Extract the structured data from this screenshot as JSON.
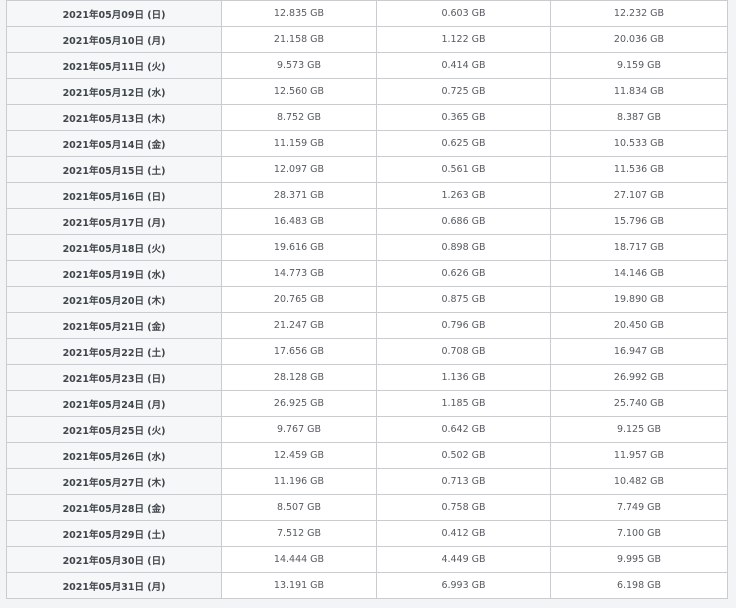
{
  "table": {
    "rows": [
      {
        "date": "2021年05月09日 (日)",
        "total": "12.835 GB",
        "upload": "0.603 GB",
        "download": "12.232 GB"
      },
      {
        "date": "2021年05月10日 (月)",
        "total": "21.158 GB",
        "upload": "1.122 GB",
        "download": "20.036 GB"
      },
      {
        "date": "2021年05月11日 (火)",
        "total": "9.573 GB",
        "upload": "0.414 GB",
        "download": "9.159 GB"
      },
      {
        "date": "2021年05月12日 (水)",
        "total": "12.560 GB",
        "upload": "0.725 GB",
        "download": "11.834 GB"
      },
      {
        "date": "2021年05月13日 (木)",
        "total": "8.752 GB",
        "upload": "0.365 GB",
        "download": "8.387 GB"
      },
      {
        "date": "2021年05月14日 (金)",
        "total": "11.159 GB",
        "upload": "0.625 GB",
        "download": "10.533 GB"
      },
      {
        "date": "2021年05月15日 (土)",
        "total": "12.097 GB",
        "upload": "0.561 GB",
        "download": "11.536 GB"
      },
      {
        "date": "2021年05月16日 (日)",
        "total": "28.371 GB",
        "upload": "1.263 GB",
        "download": "27.107 GB"
      },
      {
        "date": "2021年05月17日 (月)",
        "total": "16.483 GB",
        "upload": "0.686 GB",
        "download": "15.796 GB"
      },
      {
        "date": "2021年05月18日 (火)",
        "total": "19.616 GB",
        "upload": "0.898 GB",
        "download": "18.717 GB"
      },
      {
        "date": "2021年05月19日 (水)",
        "total": "14.773 GB",
        "upload": "0.626 GB",
        "download": "14.146 GB"
      },
      {
        "date": "2021年05月20日 (木)",
        "total": "20.765 GB",
        "upload": "0.875 GB",
        "download": "19.890 GB"
      },
      {
        "date": "2021年05月21日 (金)",
        "total": "21.247 GB",
        "upload": "0.796 GB",
        "download": "20.450 GB"
      },
      {
        "date": "2021年05月22日 (土)",
        "total": "17.656 GB",
        "upload": "0.708 GB",
        "download": "16.947 GB"
      },
      {
        "date": "2021年05月23日 (日)",
        "total": "28.128 GB",
        "upload": "1.136 GB",
        "download": "26.992 GB"
      },
      {
        "date": "2021年05月24日 (月)",
        "total": "26.925 GB",
        "upload": "1.185 GB",
        "download": "25.740 GB"
      },
      {
        "date": "2021年05月25日 (火)",
        "total": "9.767 GB",
        "upload": "0.642 GB",
        "download": "9.125 GB"
      },
      {
        "date": "2021年05月26日 (水)",
        "total": "12.459 GB",
        "upload": "0.502 GB",
        "download": "11.957 GB"
      },
      {
        "date": "2021年05月27日 (木)",
        "total": "11.196 GB",
        "upload": "0.713 GB",
        "download": "10.482 GB"
      },
      {
        "date": "2021年05月28日 (金)",
        "total": "8.507 GB",
        "upload": "0.758 GB",
        "download": "7.749 GB"
      },
      {
        "date": "2021年05月29日 (土)",
        "total": "7.512 GB",
        "upload": "0.412 GB",
        "download": "7.100 GB"
      },
      {
        "date": "2021年05月30日 (日)",
        "total": "14.444 GB",
        "upload": "4.449 GB",
        "download": "9.995 GB"
      },
      {
        "date": "2021年05月31日 (月)",
        "total": "13.191 GB",
        "upload": "6.993 GB",
        "download": "6.198 GB"
      }
    ]
  },
  "colors": {
    "page_background": "#f3f4f5",
    "border": "#c9cdd1",
    "text": "#555b61",
    "date_text": "#3f454b"
  }
}
